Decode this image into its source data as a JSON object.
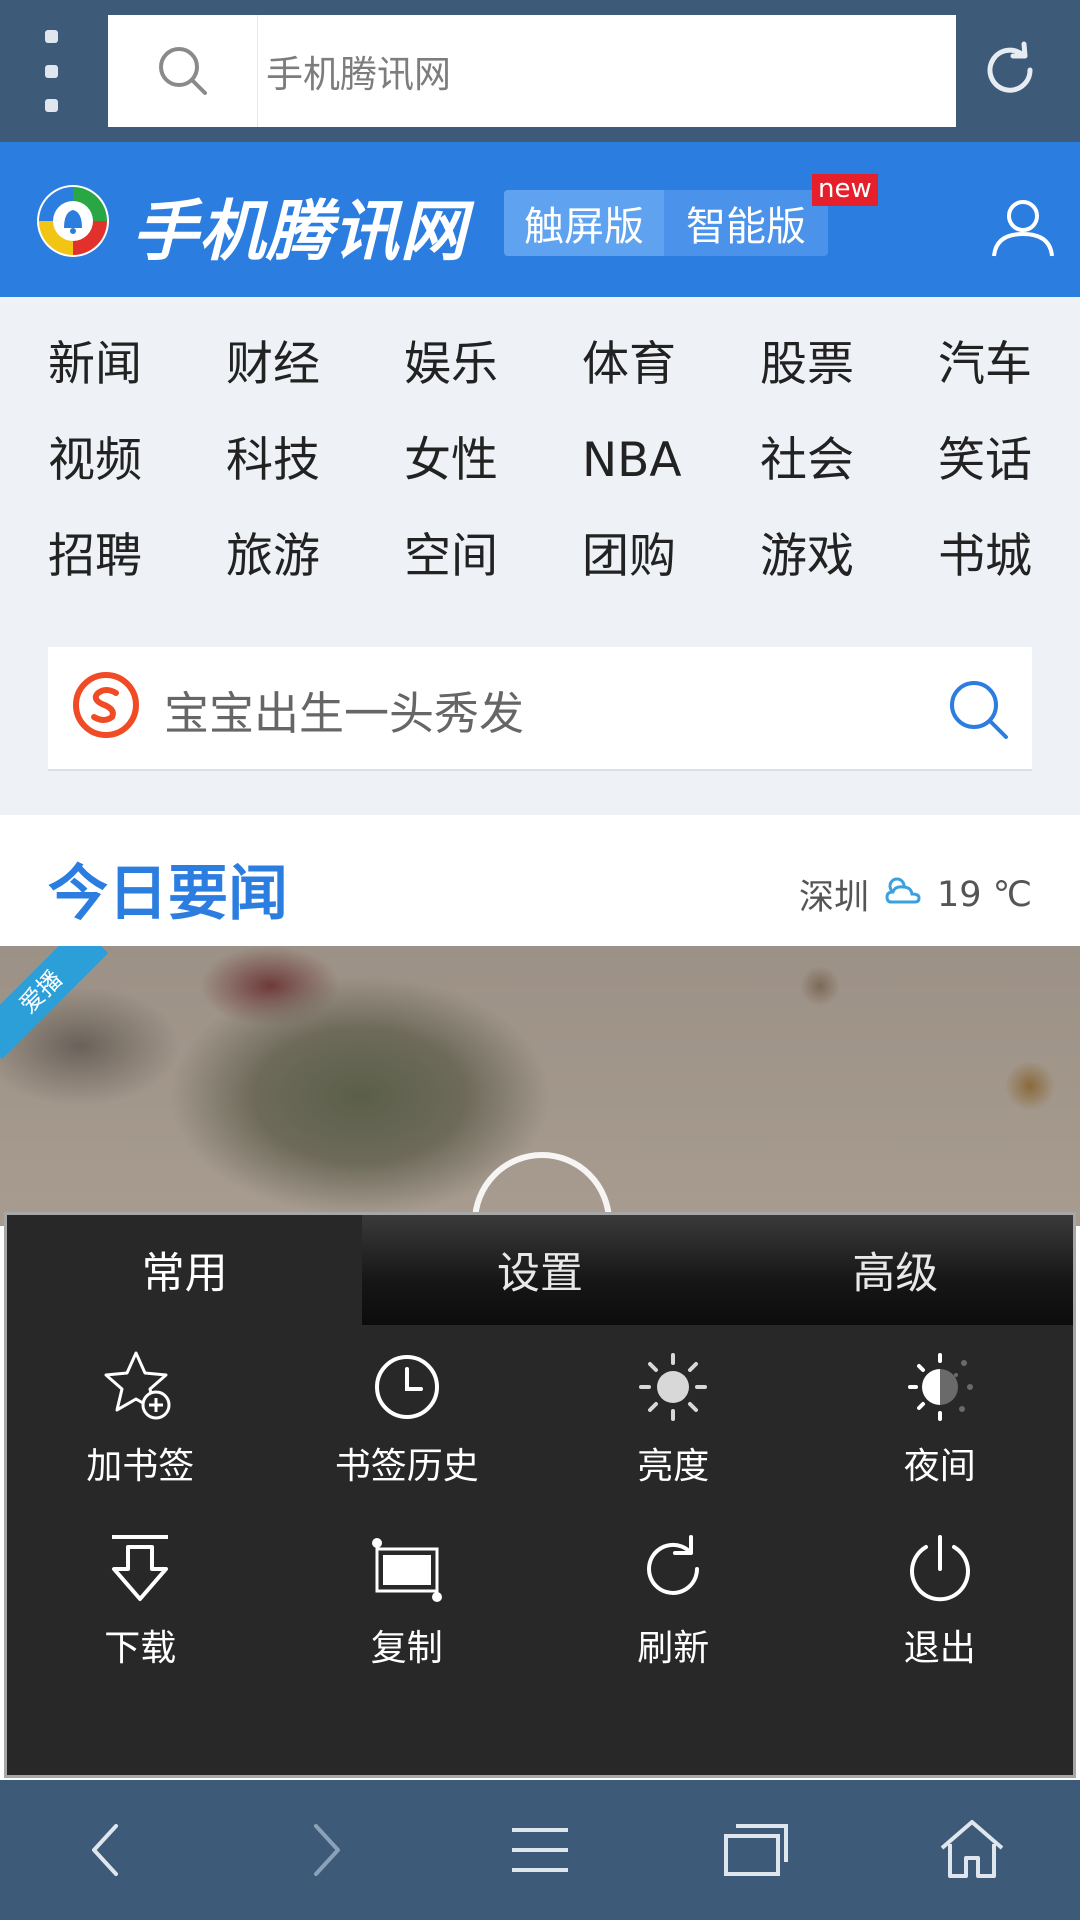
{
  "browser": {
    "url_text": "手机腾讯网"
  },
  "header": {
    "site_name": "手机腾讯网",
    "version_touch": "触屏版",
    "version_smart": "智能版",
    "new_badge": "new"
  },
  "channels": [
    "新闻",
    "财经",
    "娱乐",
    "体育",
    "股票",
    "汽车",
    "视频",
    "科技",
    "女性",
    "NBA",
    "社会",
    "笑话",
    "招聘",
    "旅游",
    "空间",
    "团购",
    "游戏",
    "书城"
  ],
  "search": {
    "placeholder": "宝宝出生一头秀发"
  },
  "news": {
    "title": "今日要闻",
    "city": "深圳",
    "temperature": "19 ℃",
    "ribbon": "爱播"
  },
  "menu": {
    "tabs": [
      "常用",
      "设置",
      "高级"
    ],
    "active_tab": "常用",
    "items": [
      {
        "label": "加书签",
        "icon": "bookmark-add-icon"
      },
      {
        "label": "书签历史",
        "icon": "history-clock-icon"
      },
      {
        "label": "亮度",
        "icon": "brightness-sun-icon"
      },
      {
        "label": "夜间",
        "icon": "night-mode-icon"
      },
      {
        "label": "下载",
        "icon": "download-arrow-icon"
      },
      {
        "label": "复制",
        "icon": "copy-select-icon"
      },
      {
        "label": "刷新",
        "icon": "refresh-icon"
      },
      {
        "label": "退出",
        "icon": "power-exit-icon"
      }
    ]
  },
  "colors": {
    "toolbar": "#3d5a78",
    "brand_blue": "#2b7de0",
    "menu_bg": "#282828",
    "badge_red": "#e5202a"
  }
}
